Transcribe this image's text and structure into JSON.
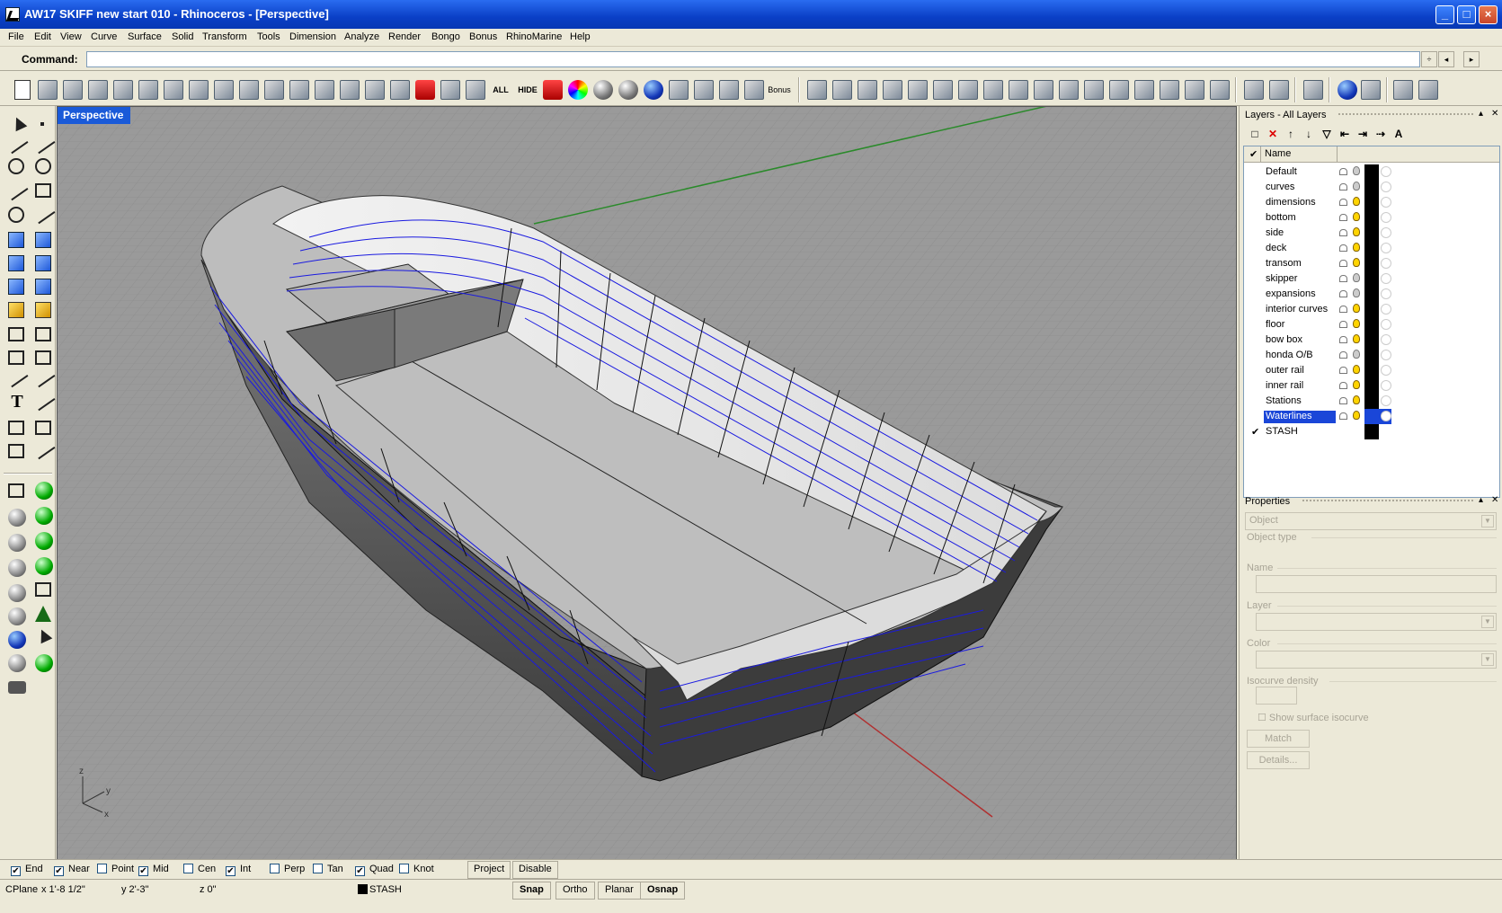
{
  "window": {
    "title": "AW17 SKIFF new start 010 - Rhinoceros - [Perspective]",
    "minimize_glyph": "_",
    "maximize_glyph": "□",
    "close_glyph": "×"
  },
  "menu": [
    "File",
    "Edit",
    "View",
    "Curve",
    "Surface",
    "Solid",
    "Transform",
    "Tools",
    "Dimension",
    "Analyze",
    "Render",
    "Bongo",
    "Bonus",
    "RhinoMarine",
    "Help"
  ],
  "command": {
    "label": "Command:",
    "value": "",
    "spin_glyph": "÷",
    "left_glyph": "◂",
    "right_glyph": "▸"
  },
  "toolbar": {
    "all_label": "ALL",
    "hide_label": "HIDE",
    "bonus_label": "Bonus"
  },
  "viewport": {
    "label": "Perspective",
    "axis_z": "z",
    "axis_y": "y",
    "axis_x": "x"
  },
  "layers": {
    "title": "Layers - All Layers",
    "header_name": "Name",
    "header_check": "✔",
    "items": [
      {
        "name": "Default",
        "on": false
      },
      {
        "name": "curves",
        "on": false
      },
      {
        "name": "dimensions",
        "on": true
      },
      {
        "name": "bottom",
        "on": true
      },
      {
        "name": "side",
        "on": true
      },
      {
        "name": "deck",
        "on": true
      },
      {
        "name": "transom",
        "on": true
      },
      {
        "name": "skipper",
        "on": false
      },
      {
        "name": "expansions",
        "on": false
      },
      {
        "name": "interior curves",
        "on": true
      },
      {
        "name": "floor",
        "on": true
      },
      {
        "name": "bow box",
        "on": true
      },
      {
        "name": "honda O/B",
        "on": false
      },
      {
        "name": "outer rail",
        "on": true
      },
      {
        "name": "inner rail",
        "on": true
      },
      {
        "name": "Stations",
        "on": true
      },
      {
        "name": "Waterlines",
        "on": true,
        "selected": true
      },
      {
        "name": "STASH",
        "on": true,
        "current": true
      }
    ],
    "current_mark": "✔"
  },
  "properties": {
    "title": "Properties",
    "object_dropdown": "Object",
    "object_type_label": "Object type",
    "name_label": "Name",
    "layer_label": "Layer",
    "color_label": "Color",
    "isocurve_label": "Isocurve density",
    "show_isocurve_label": "Show surface isocurve",
    "match_button": "Match",
    "details_button": "Details...",
    "pin_glyph": "▴",
    "close_glyph": "✕"
  },
  "osnap": {
    "items": [
      {
        "label": "End",
        "checked": true
      },
      {
        "label": "Near",
        "checked": true
      },
      {
        "label": "Point",
        "checked": false
      },
      {
        "label": "Mid",
        "checked": true
      },
      {
        "label": "Cen",
        "checked": false
      },
      {
        "label": "Int",
        "checked": true
      },
      {
        "label": "Perp",
        "checked": false
      },
      {
        "label": "Tan",
        "checked": false
      },
      {
        "label": "Quad",
        "checked": true
      },
      {
        "label": "Knot",
        "checked": false
      }
    ],
    "project_button": "Project",
    "disable_button": "Disable",
    "check_glyph": "✔"
  },
  "status": {
    "cplane": "CPlane",
    "x": "x 1'-8 1/2\"",
    "y": "y 2'-3\"",
    "z": "z 0\"",
    "layer": "STASH",
    "snap": "Snap",
    "ortho": "Ortho",
    "planar": "Planar",
    "osnap": "Osnap"
  },
  "colors": {
    "title_blue": "#0a3fc6",
    "selection_blue": "#1a46d8",
    "viewport_bg": "#9a9a9a",
    "chrome": "#ece9d8",
    "waterline_blue": "#1a1ae0"
  }
}
